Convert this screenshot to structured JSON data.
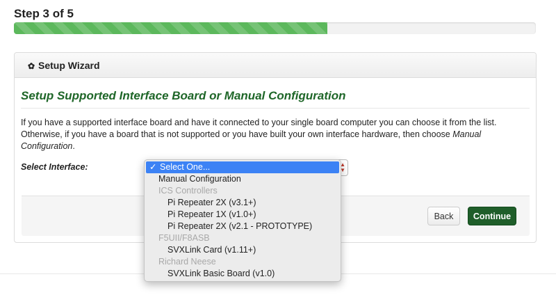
{
  "step": {
    "title": "Step 3 of 5",
    "progress_percent": 60,
    "progress_color": "#5cb85c"
  },
  "panel": {
    "heading": "Setup Wizard",
    "heading_icon": "gear-icon",
    "section_title": "Setup Supported Interface Board or Manual Configuration",
    "description_main": "If you have a supported interface board and have it connected to your single board computer you can choose it from the list. Otherwise, if you have a board that is not supported or you have built your own interface hardware, then choose ",
    "description_em": "Manual Configuration",
    "description_end": ".",
    "select_label": "Select Interface:"
  },
  "dropdown": {
    "selected_check": "✓",
    "options": [
      {
        "label": "Select One...",
        "kind": "selected"
      },
      {
        "label": "Manual Configuration",
        "kind": "option"
      },
      {
        "label": "ICS Controllers",
        "kind": "group"
      },
      {
        "label": "Pi Repeater 2X (v3.1+)",
        "kind": "child"
      },
      {
        "label": "Pi Repeater 1X (v1.0+)",
        "kind": "child"
      },
      {
        "label": "Pi Repeater 2X (v2.1 - PROTOTYPE)",
        "kind": "child"
      },
      {
        "label": "F5UII/F8ASB",
        "kind": "group"
      },
      {
        "label": "SVXLink Card (v1.11+)",
        "kind": "child"
      },
      {
        "label": "Richard Neese",
        "kind": "group"
      },
      {
        "label": "SVXLink Basic Board (v1.0)",
        "kind": "child"
      }
    ]
  },
  "buttons": {
    "back": "Back",
    "continue": "Continue",
    "continue_color": "#1f5e2a"
  }
}
